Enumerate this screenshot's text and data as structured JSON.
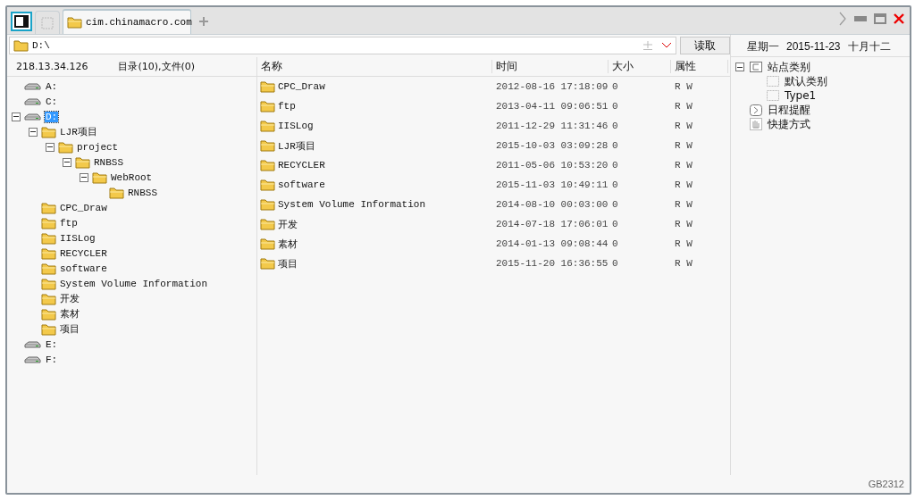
{
  "tabs": [
    {
      "kind": "panel",
      "selected": false
    },
    {
      "kind": "blank",
      "selected": false
    },
    {
      "kind": "site",
      "label": "cim.chinamacro.com",
      "selected": true
    }
  ],
  "address": {
    "value": "D:\\",
    "button": "读取"
  },
  "date": {
    "weekday": "星期一",
    "date": "2015-11-23",
    "lunar": "十月十二"
  },
  "left_header": {
    "host": "218.13.34.126",
    "summary": "目录(10),文件(0)"
  },
  "tree": [
    {
      "label": "A:",
      "kind": "drive"
    },
    {
      "label": "C:",
      "kind": "drive"
    },
    {
      "label": "D:",
      "kind": "drive",
      "selected": true,
      "expanded": true,
      "children": [
        {
          "label": "LJR项目",
          "kind": "folder",
          "expanded": true,
          "children": [
            {
              "label": "project",
              "kind": "folder",
              "expanded": true,
              "children": [
                {
                  "label": "RNBSS",
                  "kind": "folder",
                  "expanded": true,
                  "children": [
                    {
                      "label": "WebRoot",
                      "kind": "folder",
                      "expanded": true,
                      "children": [
                        {
                          "label": "RNBSS",
                          "kind": "folder"
                        }
                      ]
                    }
                  ]
                }
              ]
            }
          ]
        },
        {
          "label": "CPC_Draw",
          "kind": "folder"
        },
        {
          "label": "ftp",
          "kind": "folder"
        },
        {
          "label": "IISLog",
          "kind": "folder"
        },
        {
          "label": "RECYCLER",
          "kind": "folder"
        },
        {
          "label": "software",
          "kind": "folder"
        },
        {
          "label": "System Volume Information",
          "kind": "folder"
        },
        {
          "label": "开发",
          "kind": "folder"
        },
        {
          "label": "素材",
          "kind": "folder"
        },
        {
          "label": "项目",
          "kind": "folder"
        }
      ]
    },
    {
      "label": "E:",
      "kind": "drive"
    },
    {
      "label": "F:",
      "kind": "drive"
    }
  ],
  "table": {
    "columns": [
      "名称",
      "时间",
      "大小",
      "属性"
    ],
    "rows": [
      [
        "CPC_Draw",
        "2012-08-16 17:18:09",
        "0",
        "R W"
      ],
      [
        "ftp",
        "2013-04-11 09:06:51",
        "0",
        "R W"
      ],
      [
        "IISLog",
        "2011-12-29 11:31:46",
        "0",
        "R W"
      ],
      [
        "LJR项目",
        "2015-10-03 03:09:28",
        "0",
        "R W"
      ],
      [
        "RECYCLER",
        "2011-05-06 10:53:20",
        "0",
        "R W"
      ],
      [
        "software",
        "2015-11-03 10:49:11",
        "0",
        "R W"
      ],
      [
        "System Volume Information",
        "2014-08-10 00:03:00",
        "0",
        "R W"
      ],
      [
        "开发",
        "2014-07-18 17:06:01",
        "0",
        "R W"
      ],
      [
        "素材",
        "2014-01-13 09:08:44",
        "0",
        "R W"
      ],
      [
        "项目",
        "2015-11-20 16:36:55",
        "0",
        "R W"
      ]
    ]
  },
  "side_tree": [
    {
      "label": "站点类别",
      "kind": "category",
      "expanded": true,
      "children": [
        {
          "label": "默认类别",
          "kind": "type"
        },
        {
          "label": "Type1",
          "kind": "type"
        }
      ]
    },
    {
      "label": "日程提醒",
      "kind": "reminder"
    },
    {
      "label": "快捷方式",
      "kind": "shortcut"
    }
  ],
  "status_bar": {
    "encoding": "GB2312"
  }
}
